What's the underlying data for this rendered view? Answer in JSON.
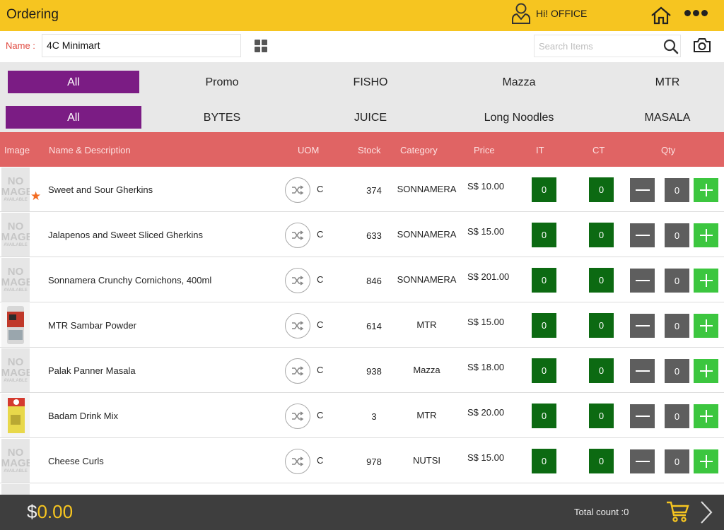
{
  "header": {
    "title": "Ordering",
    "user_greeting": "Hi! OFFICE"
  },
  "name_field": {
    "label": "Name :",
    "value": "4C Minimart"
  },
  "search": {
    "placeholder": "Search Items"
  },
  "filters_row1": [
    {
      "label": "All",
      "active": true
    },
    {
      "label": "Promo",
      "active": false
    },
    {
      "label": "FISHO",
      "active": false
    },
    {
      "label": "Mazza",
      "active": false
    },
    {
      "label": "MTR",
      "active": false
    }
  ],
  "filters_row2": [
    {
      "label": "All",
      "active": true
    },
    {
      "label": "BYTES",
      "active": false
    },
    {
      "label": "JUICE",
      "active": false
    },
    {
      "label": "Long Noodles",
      "active": false
    },
    {
      "label": "MASALA",
      "active": false
    }
  ],
  "table": {
    "columns": [
      "Image",
      "Name & Description",
      "UOM",
      "Stock",
      "Category",
      "Price",
      "IT",
      "CT",
      "Qty"
    ],
    "no_image": {
      "line1": "NO",
      "line2": "IMAGE",
      "line3": "AVAILABLE"
    },
    "rows": [
      {
        "name": "Sweet and Sour Gherkins",
        "uom": "C",
        "stock": "374",
        "category": "SONNAMERA",
        "price": "S$ 10.00",
        "it": "0",
        "ct": "0",
        "qty": "0",
        "image": "none",
        "starred": true
      },
      {
        "name": "Jalapenos and Sweet Sliced Gherkins",
        "uom": "C",
        "stock": "633",
        "category": "SONNAMERA",
        "price": "S$ 15.00",
        "it": "0",
        "ct": "0",
        "qty": "0",
        "image": "none",
        "starred": false
      },
      {
        "name": "Sonnamera Crunchy Cornichons, 400ml",
        "uom": "C",
        "stock": "846",
        "category": "SONNAMERA",
        "price": "S$ 201.00",
        "it": "0",
        "ct": "0",
        "qty": "0",
        "image": "none",
        "starred": false
      },
      {
        "name": "MTR Sambar Powder",
        "uom": "C",
        "stock": "614",
        "category": "MTR",
        "price": "S$ 15.00",
        "it": "0",
        "ct": "0",
        "qty": "0",
        "image": "product-pouch",
        "starred": false
      },
      {
        "name": "Palak Panner Masala",
        "uom": "C",
        "stock": "938",
        "category": "Mazza",
        "price": "S$ 18.00",
        "it": "0",
        "ct": "0",
        "qty": "0",
        "image": "none",
        "starred": false
      },
      {
        "name": "Badam Drink Mix",
        "uom": "C",
        "stock": "3",
        "category": "MTR",
        "price": "S$ 20.00",
        "it": "0",
        "ct": "0",
        "qty": "0",
        "image": "product-box",
        "starred": false
      },
      {
        "name": "Cheese Curls",
        "uom": "C",
        "stock": "978",
        "category": "NUTSI",
        "price": "S$ 15.00",
        "it": "0",
        "ct": "0",
        "qty": "0",
        "image": "none",
        "starred": false
      }
    ]
  },
  "footer": {
    "currency": "$",
    "amount": "0.00",
    "total_count": "Total count :0"
  },
  "colors": {
    "topbar": "#f6c520",
    "active_filter": "#7b1c84",
    "table_header": "#e06464",
    "it_ct_box": "#0c6a12",
    "plus": "#3cc63f",
    "footer": "#3e3e3e"
  },
  "icons": [
    "user-icon",
    "home-icon",
    "more-icon",
    "grid-icon",
    "search-icon",
    "camera-icon",
    "star-icon",
    "shuffle-icon",
    "minus-icon",
    "plus-icon",
    "cart-icon",
    "chevron-right-icon"
  ]
}
